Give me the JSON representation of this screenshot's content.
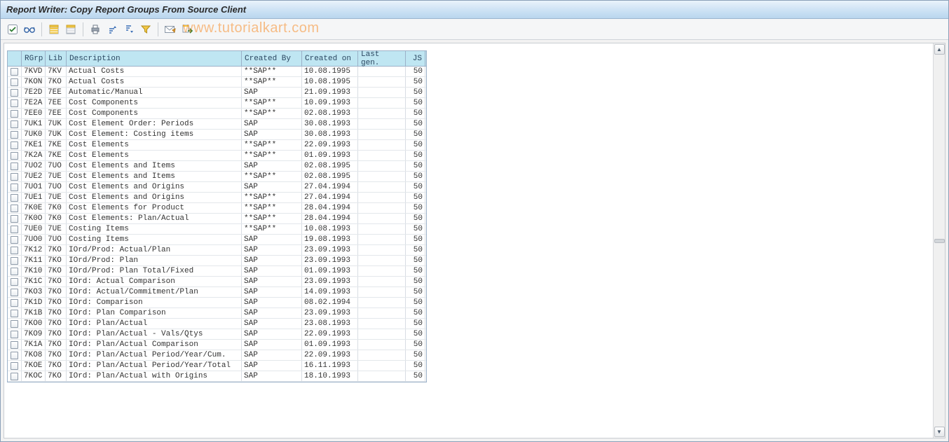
{
  "title": "Report Writer: Copy Report Groups From Source Client",
  "watermark": "www.tutorialkart.com",
  "toolbar": {
    "icons": [
      {
        "name": "check-icon",
        "title": "Check"
      },
      {
        "name": "glasses-icon",
        "title": "Display"
      },
      {
        "name": "select-all-icon",
        "title": "Select All"
      },
      {
        "name": "deselect-all-icon",
        "title": "Deselect All"
      },
      {
        "name": "print-icon",
        "title": "Print"
      },
      {
        "name": "sort-asc-icon",
        "title": "Sort Ascending"
      },
      {
        "name": "sort-desc-icon",
        "title": "Sort Descending"
      },
      {
        "name": "filter-icon",
        "title": "Filter"
      },
      {
        "name": "mail-icon",
        "title": "Mail"
      },
      {
        "name": "export-icon",
        "title": "Export"
      }
    ]
  },
  "table": {
    "headers": {
      "rgrp": "RGrp",
      "lib": "Lib",
      "desc": "Description",
      "created_by": "Created By",
      "created_on": "Created on",
      "last_gen": "Last gen.",
      "js": "JS"
    },
    "rows": [
      {
        "rgrp": "7KVD",
        "lib": "7KV",
        "desc": "Actual Costs",
        "by": "**SAP**",
        "on": "10.08.1995",
        "lg": "",
        "js": "50"
      },
      {
        "rgrp": "7KON",
        "lib": "7KO",
        "desc": "Actual Costs",
        "by": "**SAP**",
        "on": "10.08.1995",
        "lg": "",
        "js": "50"
      },
      {
        "rgrp": "7E2D",
        "lib": "7EE",
        "desc": "Automatic/Manual",
        "by": "SAP",
        "on": "21.09.1993",
        "lg": "",
        "js": "50"
      },
      {
        "rgrp": "7E2A",
        "lib": "7EE",
        "desc": "Cost Components",
        "by": "**SAP**",
        "on": "10.09.1993",
        "lg": "",
        "js": "50"
      },
      {
        "rgrp": "7EE0",
        "lib": "7EE",
        "desc": "Cost Components",
        "by": "**SAP**",
        "on": "02.08.1993",
        "lg": "",
        "js": "50"
      },
      {
        "rgrp": "7UK1",
        "lib": "7UK",
        "desc": "Cost Element Order: Periods",
        "by": "SAP",
        "on": "30.08.1993",
        "lg": "",
        "js": "50"
      },
      {
        "rgrp": "7UK0",
        "lib": "7UK",
        "desc": "Cost Element: Costing items",
        "by": "SAP",
        "on": "30.08.1993",
        "lg": "",
        "js": "50"
      },
      {
        "rgrp": "7KE1",
        "lib": "7KE",
        "desc": "Cost Elements",
        "by": "**SAP**",
        "on": "22.09.1993",
        "lg": "",
        "js": "50"
      },
      {
        "rgrp": "7K2A",
        "lib": "7KE",
        "desc": "Cost Elements",
        "by": "**SAP**",
        "on": "01.09.1993",
        "lg": "",
        "js": "50"
      },
      {
        "rgrp": "7UO2",
        "lib": "7UO",
        "desc": "Cost Elements and Items",
        "by": "SAP",
        "on": "02.08.1995",
        "lg": "",
        "js": "50"
      },
      {
        "rgrp": "7UE2",
        "lib": "7UE",
        "desc": "Cost Elements and Items",
        "by": "**SAP**",
        "on": "02.08.1995",
        "lg": "",
        "js": "50"
      },
      {
        "rgrp": "7UO1",
        "lib": "7UO",
        "desc": "Cost Elements and Origins",
        "by": "SAP",
        "on": "27.04.1994",
        "lg": "",
        "js": "50"
      },
      {
        "rgrp": "7UE1",
        "lib": "7UE",
        "desc": "Cost Elements and Origins",
        "by": "**SAP**",
        "on": "27.04.1994",
        "lg": "",
        "js": "50"
      },
      {
        "rgrp": "7K0E",
        "lib": "7K0",
        "desc": "Cost Elements for Product",
        "by": "**SAP**",
        "on": "28.04.1994",
        "lg": "",
        "js": "50"
      },
      {
        "rgrp": "7K0O",
        "lib": "7K0",
        "desc": "Cost Elements: Plan/Actual",
        "by": "**SAP**",
        "on": "28.04.1994",
        "lg": "",
        "js": "50"
      },
      {
        "rgrp": "7UE0",
        "lib": "7UE",
        "desc": "Costing Items",
        "by": "**SAP**",
        "on": "10.08.1993",
        "lg": "",
        "js": "50"
      },
      {
        "rgrp": "7UO0",
        "lib": "7UO",
        "desc": "Costing Items",
        "by": "SAP",
        "on": "19.08.1993",
        "lg": "",
        "js": "50"
      },
      {
        "rgrp": "7K12",
        "lib": "7KO",
        "desc": "IOrd/Prod: Actual/Plan",
        "by": "SAP",
        "on": "23.09.1993",
        "lg": "",
        "js": "50"
      },
      {
        "rgrp": "7K11",
        "lib": "7KO",
        "desc": "IOrd/Prod: Plan",
        "by": "SAP",
        "on": "23.09.1993",
        "lg": "",
        "js": "50"
      },
      {
        "rgrp": "7K10",
        "lib": "7KO",
        "desc": "IOrd/Prod: Plan Total/Fixed",
        "by": "SAP",
        "on": "01.09.1993",
        "lg": "",
        "js": "50"
      },
      {
        "rgrp": "7K1C",
        "lib": "7KO",
        "desc": "IOrd: Actual Comparison",
        "by": "SAP",
        "on": "23.09.1993",
        "lg": "",
        "js": "50"
      },
      {
        "rgrp": "7KO3",
        "lib": "7KO",
        "desc": "IOrd: Actual/Commitment/Plan",
        "by": "SAP",
        "on": "14.09.1993",
        "lg": "",
        "js": "50"
      },
      {
        "rgrp": "7K1D",
        "lib": "7KO",
        "desc": "IOrd: Comparison",
        "by": "SAP",
        "on": "08.02.1994",
        "lg": "",
        "js": "50"
      },
      {
        "rgrp": "7K1B",
        "lib": "7KO",
        "desc": "IOrd: Plan Comparison",
        "by": "SAP",
        "on": "23.09.1993",
        "lg": "",
        "js": "50"
      },
      {
        "rgrp": "7KO0",
        "lib": "7KO",
        "desc": "IOrd: Plan/Actual",
        "by": "SAP",
        "on": "23.08.1993",
        "lg": "",
        "js": "50"
      },
      {
        "rgrp": "7KO9",
        "lib": "7KO",
        "desc": "IOrd: Plan/Actual - Vals/Qtys",
        "by": "SAP",
        "on": "22.09.1993",
        "lg": "",
        "js": "50"
      },
      {
        "rgrp": "7K1A",
        "lib": "7KO",
        "desc": "IOrd: Plan/Actual Comparison",
        "by": "SAP",
        "on": "01.09.1993",
        "lg": "",
        "js": "50"
      },
      {
        "rgrp": "7KO8",
        "lib": "7KO",
        "desc": "IOrd: Plan/Actual Period/Year/Cum.",
        "by": "SAP",
        "on": "22.09.1993",
        "lg": "",
        "js": "50"
      },
      {
        "rgrp": "7KOE",
        "lib": "7KO",
        "desc": "IOrd: Plan/Actual Period/Year/Total",
        "by": "SAP",
        "on": "16.11.1993",
        "lg": "",
        "js": "50"
      },
      {
        "rgrp": "7KOC",
        "lib": "7KO",
        "desc": "IOrd: Plan/Actual with Origins",
        "by": "SAP",
        "on": "18.10.1993",
        "lg": "",
        "js": "50"
      }
    ]
  }
}
